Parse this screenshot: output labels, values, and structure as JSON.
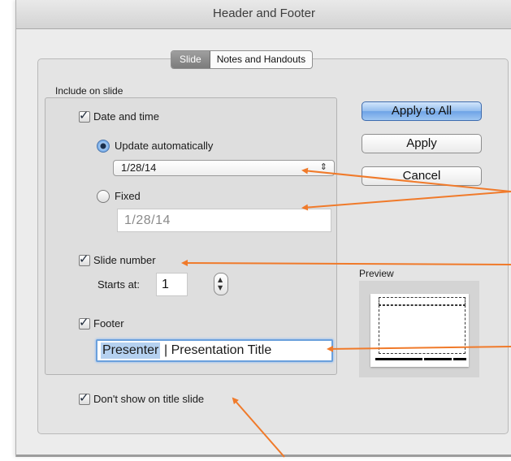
{
  "window": {
    "title": "Header and Footer"
  },
  "tabs": [
    {
      "label": "Slide",
      "selected": true
    },
    {
      "label": "Notes and Handouts",
      "selected": false
    }
  ],
  "include_group": {
    "label": "Include on slide",
    "date_time": {
      "label": "Date and time",
      "checked": true,
      "update_auto_label": "Update automatically",
      "update_auto_selected": true,
      "date_select_value": "1/28/14",
      "fixed_label": "Fixed",
      "fixed_value": "1/28/14"
    },
    "slide_number": {
      "label": "Slide number",
      "checked": true,
      "starts_at_label": "Starts at:",
      "starts_at_value": "1"
    },
    "footer": {
      "label": "Footer",
      "checked": true,
      "value_selected": "Presenter",
      "value_rest": "| Presentation Title"
    }
  },
  "dont_show_title": {
    "label": "Don't show on title slide",
    "checked": true
  },
  "buttons": {
    "apply_all": "Apply to All",
    "apply": "Apply",
    "cancel": "Cancel"
  },
  "preview": {
    "label": "Preview"
  },
  "colors": {
    "annotation_arrow": "#f07a2a",
    "default_button": "#6ea3e6",
    "focus_ring": "#6aa0dc"
  },
  "icons": {
    "checkbox": "checkmark-icon",
    "select_arrow": "updown-chevron-icon",
    "stepper": "stepper-icon"
  }
}
